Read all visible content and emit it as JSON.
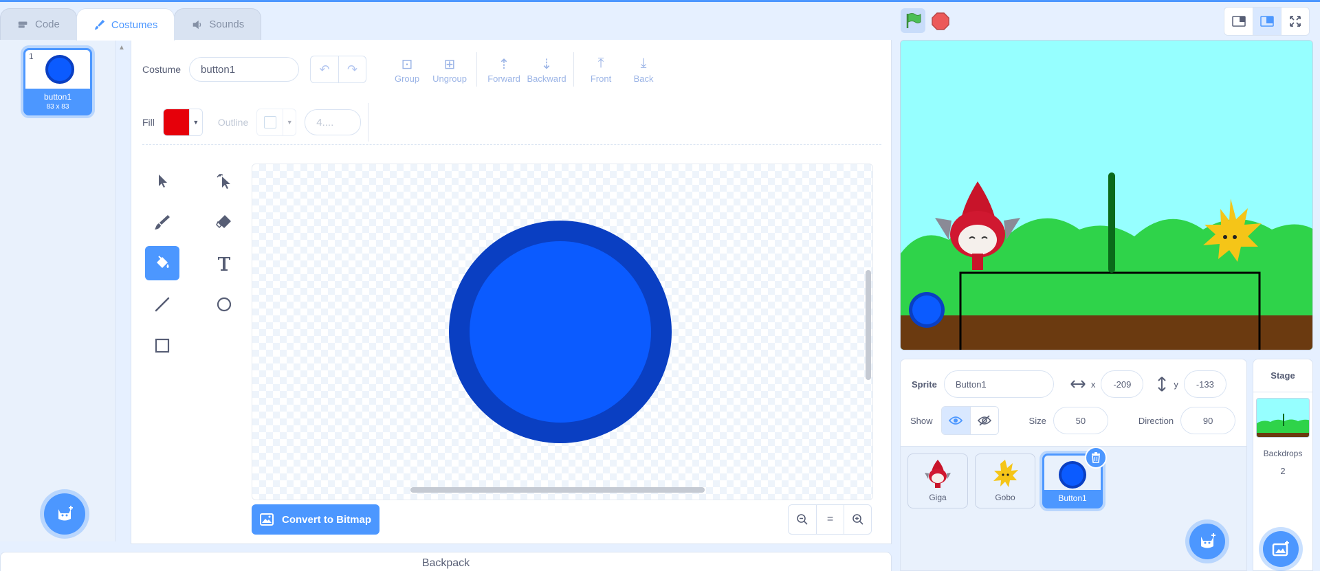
{
  "tabs": [
    {
      "label": "Code",
      "icon": "code-icon"
    },
    {
      "label": "Costumes",
      "icon": "brush-icon"
    },
    {
      "label": "Sounds",
      "icon": "speaker-icon"
    }
  ],
  "costume_list": {
    "items": [
      {
        "number": "1",
        "name": "button1",
        "size": "83 x 83"
      }
    ]
  },
  "editor": {
    "costume_label": "Costume",
    "costume_name": "button1",
    "buttons": {
      "group": "Group",
      "ungroup": "Ungroup",
      "forward": "Forward",
      "backward": "Backward",
      "front": "Front",
      "back": "Back"
    },
    "fill_label": "Fill",
    "fill_color": "#e6000a",
    "outline_label": "Outline",
    "outline_width": "4....",
    "convert_label": "Convert to Bitmap",
    "zoom_reset": "="
  },
  "backpack_label": "Backpack",
  "sprite_info": {
    "sprite_label": "Sprite",
    "sprite_name": "Button1",
    "x_label": "x",
    "x_value": "-209",
    "y_label": "y",
    "y_value": "-133",
    "show_label": "Show",
    "size_label": "Size",
    "size_value": "50",
    "direction_label": "Direction",
    "direction_value": "90"
  },
  "sprites": [
    {
      "name": "Giga"
    },
    {
      "name": "Gobo"
    },
    {
      "name": "Button1"
    }
  ],
  "stage_panel": {
    "title": "Stage",
    "backdrops_label": "Backdrops",
    "backdrops_count": "2"
  },
  "colors": {
    "accent": "#4c97ff",
    "costume_fill": "#0b5bff",
    "costume_outline": "#0a3fc2"
  }
}
